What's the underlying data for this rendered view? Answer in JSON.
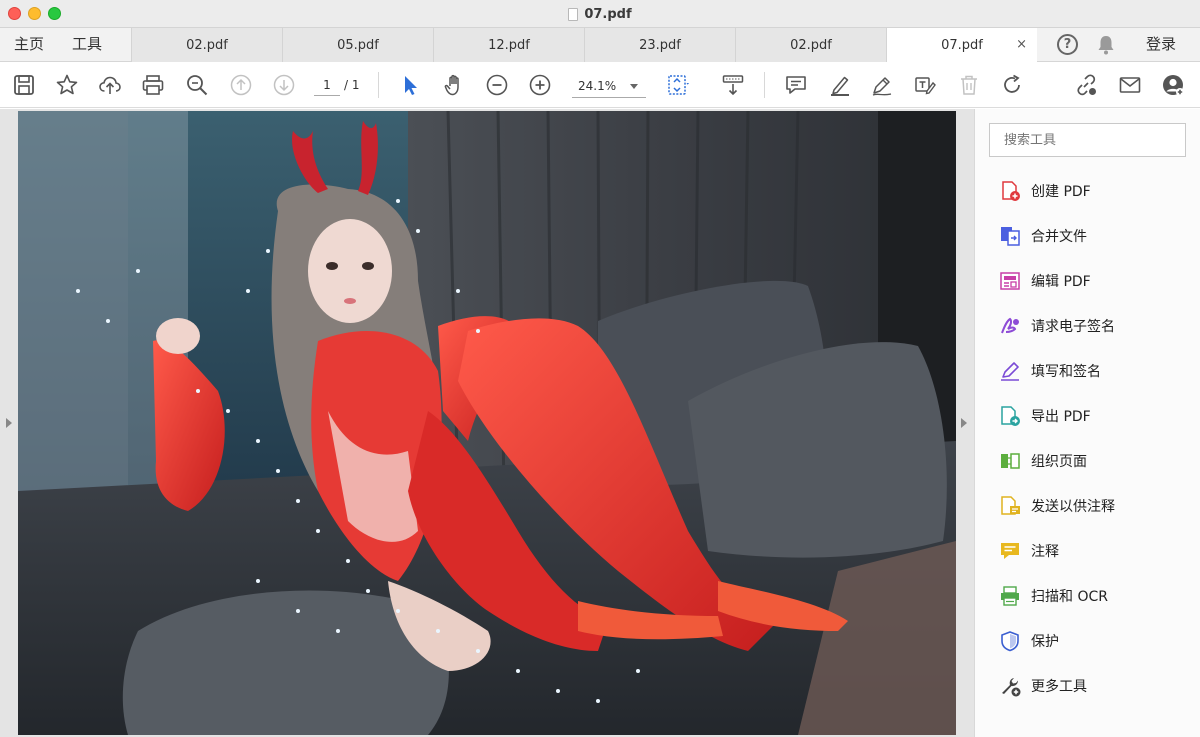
{
  "window": {
    "title": "07.pdf"
  },
  "nav": {
    "home": "主页",
    "tools": "工具",
    "login": "登录"
  },
  "tabs": [
    {
      "label": "02.pdf"
    },
    {
      "label": "05.pdf"
    },
    {
      "label": "12.pdf"
    },
    {
      "label": "23.pdf"
    },
    {
      "label": "02.pdf"
    },
    {
      "label": "07.pdf",
      "active": true,
      "close": "×"
    }
  ],
  "toolbar": {
    "page_current": "1",
    "page_total": "/ 1",
    "zoom": "24.1%",
    "icons": [
      "save-icon",
      "star-icon",
      "cloud-upload-icon",
      "print-icon",
      "zoom-search-icon",
      "page-up-icon",
      "page-down-icon",
      "pointer-icon",
      "hand-icon",
      "zoom-out-icon",
      "zoom-in-icon",
      "fit-page-icon",
      "scroll-mode-icon",
      "comment-icon",
      "highlight-icon",
      "sign-icon",
      "edit-text-icon",
      "delete-icon",
      "rotate-icon",
      "share-link-icon",
      "email-icon",
      "account-icon"
    ]
  },
  "panel": {
    "search_placeholder": "搜索工具",
    "tools": [
      {
        "label": "创建 PDF",
        "icon": "create-pdf-icon",
        "color": "#e0393e"
      },
      {
        "label": "合并文件",
        "icon": "combine-files-icon",
        "color": "#4b5fe0"
      },
      {
        "label": "编辑 PDF",
        "icon": "edit-pdf-icon",
        "color": "#c83fa8"
      },
      {
        "label": "请求电子签名",
        "icon": "request-sign-icon",
        "color": "#8d4bd6"
      },
      {
        "label": "填写和签名",
        "icon": "fill-sign-icon",
        "color": "#7b4bd6"
      },
      {
        "label": "导出 PDF",
        "icon": "export-pdf-icon",
        "color": "#2aa3a0"
      },
      {
        "label": "组织页面",
        "icon": "organize-pages-icon",
        "color": "#5cae3e"
      },
      {
        "label": "发送以供注释",
        "icon": "send-comment-icon",
        "color": "#e0b320"
      },
      {
        "label": "注释",
        "icon": "comment-tool-icon",
        "color": "#e8b81f"
      },
      {
        "label": "扫描和 OCR",
        "icon": "scan-ocr-icon",
        "color": "#4fa84a"
      },
      {
        "label": "保护",
        "icon": "protect-icon",
        "color": "#3b5fd1"
      },
      {
        "label": "更多工具",
        "icon": "more-tools-icon",
        "color": "#444444"
      }
    ]
  }
}
